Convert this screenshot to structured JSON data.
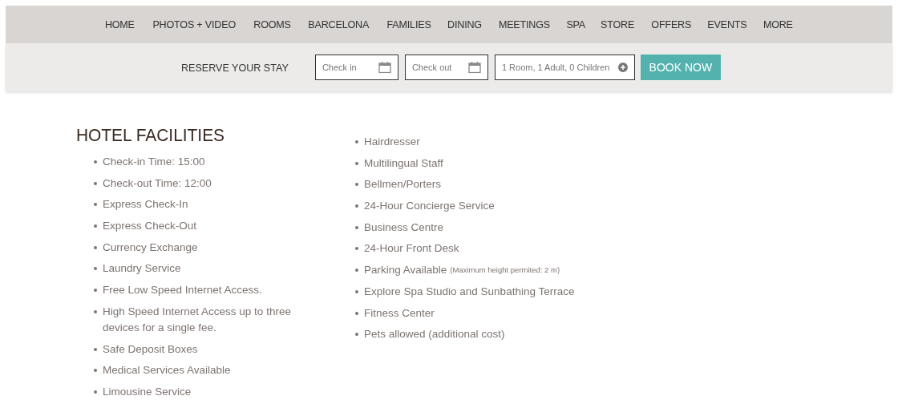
{
  "nav": {
    "items": [
      {
        "label": "HOME"
      },
      {
        "label": "PHOTOS + VIDEO"
      },
      {
        "label": "ROOMS"
      },
      {
        "label": "BARCELONA"
      },
      {
        "label": "FAMILIES"
      },
      {
        "label": "DINING"
      },
      {
        "label": "MEETINGS"
      },
      {
        "label": "SPA"
      },
      {
        "label": "STORE"
      },
      {
        "label": "OFFERS"
      },
      {
        "label": "EVENTS"
      },
      {
        "label": "MORE"
      }
    ]
  },
  "reserve": {
    "label": "RESERVE YOUR STAY",
    "fields": [
      {
        "kind": "date",
        "placeholder": "Check in"
      },
      {
        "kind": "date",
        "placeholder": "Check out"
      },
      {
        "kind": "guests",
        "placeholder": "1 Room, 1 Adult, 0 Children"
      }
    ],
    "button": "BOOK NOW"
  },
  "facilities": {
    "title": "HOTEL FACILITIES",
    "columns": [
      [
        {
          "text": "Check-in Time: 15:00"
        },
        {
          "text": "Check-out Time: 12:00"
        },
        {
          "text": "Express Check-In"
        },
        {
          "text": "Express Check-Out"
        },
        {
          "text": "Currency Exchange"
        },
        {
          "text": "Laundry Service"
        },
        {
          "text": "Free Low Speed Internet Access."
        },
        {
          "text": "High Speed Internet Access up to three devices for a single fee."
        },
        {
          "text": "Safe Deposit Boxes"
        },
        {
          "text": "Medical Services Available"
        },
        {
          "text": "Limousine Service"
        }
      ],
      [
        {
          "text": "Hairdresser"
        },
        {
          "text": "Multilingual Staff"
        },
        {
          "text": "Bellmen/Porters"
        },
        {
          "text": "24-Hour Concierge Service"
        },
        {
          "text": "Business Centre"
        },
        {
          "text": "24-Hour Front Desk"
        },
        {
          "text": "Parking Available",
          "note": "(Maximum height permited: 2 m)"
        },
        {
          "text": "Explore Spa Studio and Sunbathing Terrace"
        },
        {
          "text": "Fitness Center"
        },
        {
          "text": "Pets allowed (additional cost)"
        }
      ]
    ]
  }
}
